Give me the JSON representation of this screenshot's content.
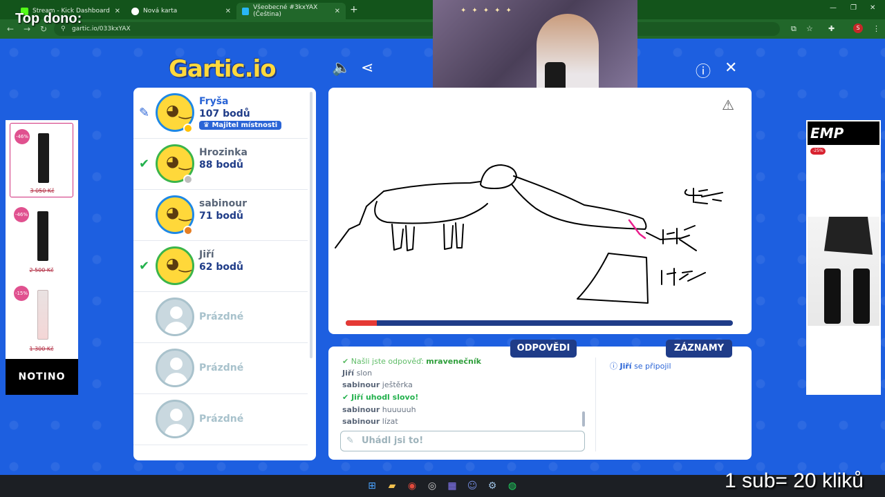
{
  "browser": {
    "tabs": [
      {
        "label": "Stream - Kick Dashboard",
        "color": "#53fc18"
      },
      {
        "label": "Nová karta",
        "color": "#ffffff"
      },
      {
        "label": "Všeobecné #3kxYAX (Čeština)",
        "color": "#29b6f6"
      }
    ],
    "new_tab_icon": "plus-icon",
    "url": "gartic.io/033kxYAX",
    "profile_letter": "S"
  },
  "overlay": {
    "top_dono": "Top dono:",
    "sub_text": "1 sub= 20 kliků"
  },
  "game": {
    "logo": "Gartic.io",
    "players": [
      {
        "name": "Fryša",
        "score": "107 bodů",
        "badge": "Majitel místnosti",
        "status": "drawing",
        "dot_color": "#ffc107"
      },
      {
        "name": "Hrozinka",
        "score": "88 bodů",
        "status": "guessed",
        "dot_color": "#bdbdbd"
      },
      {
        "name": "sabinour",
        "score": "71 bodů",
        "status": "none",
        "dot_color": "#e67e22"
      },
      {
        "name": "Jiří",
        "score": "62 bodů",
        "status": "guessed",
        "dot_color": null
      },
      {
        "name": "Prázdné"
      },
      {
        "name": "Prázdné"
      },
      {
        "name": "Prázdné"
      }
    ],
    "progress_fraction": 0.08,
    "tabs": {
      "answers": "ODPOVĚDI",
      "records": "ZÁZNAMY"
    },
    "chat": [
      {
        "type": "system",
        "text": "Našli jste odpověď: ",
        "word": "mravenečník"
      },
      {
        "type": "msg",
        "user": "Jiří",
        "text": "slon"
      },
      {
        "type": "msg",
        "user": "sabinour",
        "text": "ještěrka"
      },
      {
        "type": "guess",
        "user": "Jiří",
        "text": "uhodl slovo!"
      },
      {
        "type": "msg",
        "user": "sabinour",
        "text": "huuuuuh"
      },
      {
        "type": "msg",
        "user": "sabinour",
        "text": "lízat"
      }
    ],
    "answer_placeholder": "Uhádl jsi to!",
    "records": [
      {
        "user": "Jiří",
        "text": "se připojil"
      }
    ]
  },
  "ads": {
    "left": {
      "brand": "NOTINO",
      "products": [
        {
          "discount": "-46%",
          "price": "3 050 Kč"
        },
        {
          "discount": "-46%",
          "price": "2 500 Kč"
        },
        {
          "discount": "-15%",
          "price": "1 300 Kč"
        }
      ]
    },
    "right": {
      "brand": "EMP",
      "discount": "-25%"
    }
  }
}
